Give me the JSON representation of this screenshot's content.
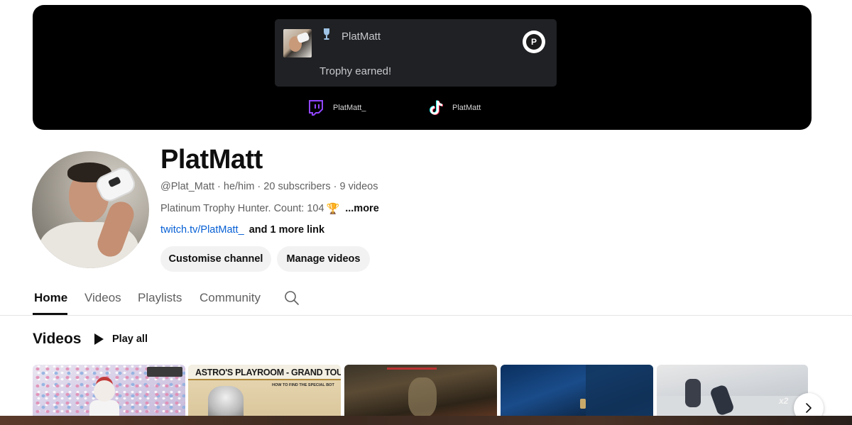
{
  "banner": {
    "notification": {
      "user": "PlatMatt",
      "message": "Trophy earned!"
    },
    "socials": [
      {
        "name": "PlatMatt_",
        "icon": "twitch-icon"
      },
      {
        "name": "PlatMatt",
        "icon": "tiktok-icon"
      }
    ]
  },
  "channel": {
    "name": "PlatMatt",
    "handle": "@Plat_Matt",
    "pronouns": "he/him",
    "subscribers": "20 subscribers",
    "videos": "9 videos",
    "description": "Platinum Trophy Hunter. Count: 104",
    "description_more": "...more",
    "link": "twitch.tv/PlatMatt_",
    "more_links": "and 1 more link",
    "buttons": {
      "customise": "Customise channel",
      "manage": "Manage videos"
    }
  },
  "tabs": [
    {
      "label": "Home",
      "active": true
    },
    {
      "label": "Videos",
      "active": false
    },
    {
      "label": "Playlists",
      "active": false
    },
    {
      "label": "Community",
      "active": false
    }
  ],
  "videos_section": {
    "title": "Videos",
    "play_all": "Play all",
    "thumbnails": [
      {
        "id": 1
      },
      {
        "id": 2,
        "title": "ASTRO'S PLAYROOM - GRAND TOURIST TROPHY",
        "subtitle": "HOW TO FIND THE SPECIAL BOT"
      },
      {
        "id": 3
      },
      {
        "id": 4
      },
      {
        "id": 5,
        "overlay": "x2"
      }
    ]
  },
  "colors": {
    "accent_link": "#065fd4",
    "twitch": "#9146ff",
    "button_bg": "#f2f2f2"
  }
}
